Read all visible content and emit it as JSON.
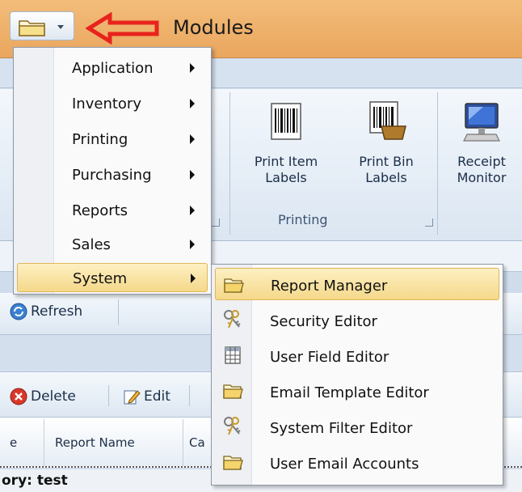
{
  "title_bar": {
    "title": "Modules",
    "app_button_icon": "folder-icon"
  },
  "ribbon": {
    "buttons": [
      {
        "label_line1": "Print Item",
        "label_line2": "Labels",
        "icon": "barcode-icon"
      },
      {
        "label_line1": "Print Bin",
        "label_line2": "Labels",
        "icon": "barcode-bin-icon"
      },
      {
        "label_line1": "Receipt",
        "label_line2": "Monitor",
        "icon": "monitor-icon"
      }
    ],
    "group_label": "Printing"
  },
  "toolbar": {
    "refresh_label": "Refresh",
    "delete_label": "Delete",
    "edit_label": "Edit"
  },
  "grid": {
    "headers": [
      "e",
      "Report Name",
      "Ca"
    ],
    "group_row": "ory: test"
  },
  "modules_menu": {
    "items": [
      {
        "label": "Application",
        "has_submenu": true
      },
      {
        "label": "Inventory",
        "has_submenu": true
      },
      {
        "label": "Printing",
        "has_submenu": true
      },
      {
        "label": "Purchasing",
        "has_submenu": true
      },
      {
        "label": "Reports",
        "has_submenu": true
      },
      {
        "label": "Sales",
        "has_submenu": true
      },
      {
        "label": "System",
        "has_submenu": true,
        "highlighted": true
      }
    ]
  },
  "system_menu": {
    "items": [
      {
        "label": "Report Manager",
        "icon": "folder-open-icon",
        "highlighted": true
      },
      {
        "label": "Security Editor",
        "icon": "keys-icon"
      },
      {
        "label": "User Field Editor",
        "icon": "table-icon"
      },
      {
        "label": "Email Template Editor",
        "icon": "folder-open-icon"
      },
      {
        "label": "System Filter Editor",
        "icon": "keys-icon"
      },
      {
        "label": "User Email Accounts",
        "icon": "folder-open-icon"
      }
    ]
  },
  "colors": {
    "title_bar": "#eaa65e",
    "highlight": "#f5d88a",
    "arrow": "#e8231d"
  }
}
